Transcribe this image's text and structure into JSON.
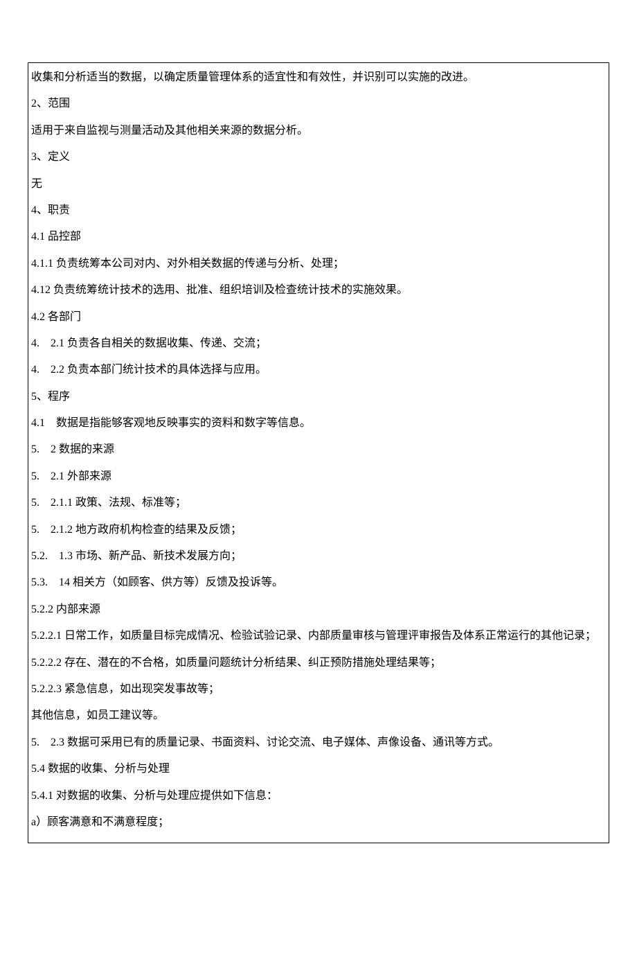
{
  "lines": [
    {
      "text": "收集和分析适当的数据，以确定质量管理体系的适宜性和有效性，并识别可以实施的改进。"
    },
    {
      "text": "2、范围"
    },
    {
      "text": "适用于来自监视与测量活动及其他相关来源的数据分析。"
    },
    {
      "text": "3、定义"
    },
    {
      "text": "无"
    },
    {
      "text": "4、职责"
    },
    {
      "text": "4.1 品控部"
    },
    {
      "text": "4.1.1 负责统筹本公司对内、对外相关数据的传递与分析、处理；"
    },
    {
      "text": "4.12 负责统筹统计技术的选用、批准、组织培训及检查统计技术的实施效果。"
    },
    {
      "text": "4.2 各部门"
    },
    {
      "text": "4.　2.1 负责各自相关的数据收集、传递、交流；"
    },
    {
      "text": "4.　2.2 负责本部门统计技术的具体选择与应用。"
    },
    {
      "text": "5、程序"
    },
    {
      "text": "4.1　数据是指能够客观地反映事实的资料和数字等信息。"
    },
    {
      "text": "5.　2 数据的来源"
    },
    {
      "text": "5.　2.1 外部来源"
    },
    {
      "text": "5.　2.1.1 政策、法规、标准等；"
    },
    {
      "text": "5.　2.1.2 地方政府机构检查的结果及反馈；"
    },
    {
      "text": "5.2.　1.3 市场、新产品、新技术发展方向；"
    },
    {
      "text": "5.3.　14 相关方（如顾客、供方等）反馈及投诉等。"
    },
    {
      "text": "5.2.2 内部来源"
    },
    {
      "text": "5.2.2.1 日常工作，如质量目标完成情况、检验试验记录、内部质量审核与管理评审报告及体系正常运行的其他记录；"
    },
    {
      "text": "5.2.2.2 存在、潜在的不合格，如质量问题统计分析结果、纠正预防措施处理结果等；"
    },
    {
      "text": "5.2.2.3 紧急信息，如出现突发事故等；"
    },
    {
      "text": "其他信息，如员工建议等。"
    },
    {
      "text": "5.　2.3 数据可采用已有的质量记录、书面资料、讨论交流、电子媒体、声像设备、通讯等方式。"
    },
    {
      "text": "5.4 数据的收集、分析与处理"
    },
    {
      "text": "5.4.1 对数据的收集、分析与处理应提供如下信息："
    },
    {
      "text": "a）顾客满意和不满意程度；"
    }
  ]
}
